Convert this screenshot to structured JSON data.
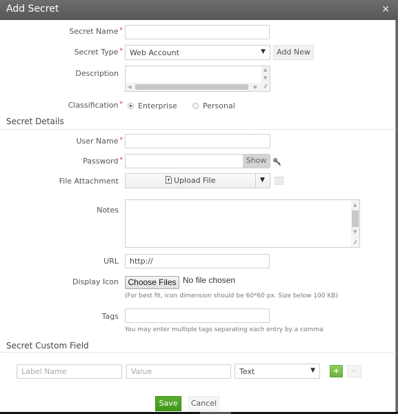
{
  "dialog": {
    "title": "Add Secret",
    "close_icon": "close-icon"
  },
  "form": {
    "secret_name": {
      "label": "Secret Name",
      "required_mark": "*",
      "value": ""
    },
    "secret_type": {
      "label": "Secret Type",
      "required_mark": "*",
      "selected": "Web Account",
      "add_new_label": "Add New"
    },
    "description": {
      "label": "Description",
      "value": ""
    },
    "classification": {
      "label": "Classification",
      "required_mark": "*",
      "options": [
        {
          "label": "Enterprise",
          "checked": true
        },
        {
          "label": "Personal",
          "checked": false
        }
      ]
    }
  },
  "secret_details": {
    "title": "Secret Details",
    "user_name": {
      "label": "User Name",
      "required_mark": "*",
      "value": ""
    },
    "password": {
      "label": "Password",
      "required_mark": "*",
      "value": "",
      "show_label": "Show",
      "key_icon": "key-icon"
    },
    "file_attachment": {
      "label": "File Attachment",
      "upload_label": "Upload File",
      "upload_icon": "file-upload-icon",
      "calendar_icon": "calendar-icon"
    },
    "notes": {
      "label": "Notes",
      "value": ""
    },
    "url": {
      "label": "URL",
      "value": "http://"
    },
    "display_icon": {
      "label": "Display Icon",
      "choose_label": "Choose Files",
      "status": "No file chosen",
      "hint": "(For best fit, icon dimension should be 60*60 px. Size below 100 KB)"
    },
    "tags": {
      "label": "Tags",
      "value": "",
      "hint": "You may enter multiple tags separating each entry by a comma"
    }
  },
  "custom_field": {
    "title": "Secret Custom Field",
    "label_placeholder": "Label Name",
    "value_placeholder": "Value",
    "type_selected": "Text",
    "add_icon": "plus-icon",
    "remove_icon": "minus-icon"
  },
  "actions": {
    "save_label": "Save",
    "cancel_label": "Cancel"
  },
  "colors": {
    "title_bar": "#5f5f5f",
    "required": "#c9302c",
    "save_green": "#4a9e22",
    "add_green": "#78bd4a"
  }
}
